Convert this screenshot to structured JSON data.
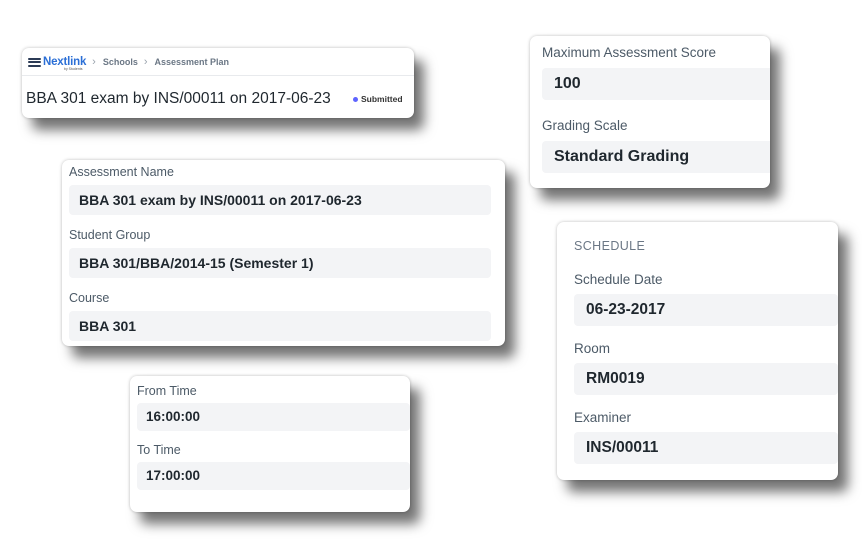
{
  "header": {
    "logo_text": "Nextlink",
    "logo_subtext": "by Students",
    "breadcrumbs": [
      "Schools",
      "Assessment Plan"
    ],
    "title": "BBA 301 exam by INS/00011 on 2017-06-23",
    "status": "Submitted",
    "status_color": "#5e64ff"
  },
  "assessment": {
    "name_label": "Assessment Name",
    "name_value": "BBA 301 exam by INS/00011 on 2017-06-23",
    "group_label": "Student Group",
    "group_value": "BBA 301/BBA/2014-15 (Semester 1)",
    "course_label": "Course",
    "course_value": "BBA 301"
  },
  "scoring": {
    "max_score_label": "Maximum Assessment Score",
    "max_score_value": "100",
    "grading_scale_label": "Grading Scale",
    "grading_scale_value": "Standard Grading"
  },
  "time": {
    "from_label": "From Time",
    "from_value": "16:00:00",
    "to_label": "To Time",
    "to_value": "17:00:00"
  },
  "schedule": {
    "section_title": "SCHEDULE",
    "date_label": "Schedule Date",
    "date_value": "06-23-2017",
    "room_label": "Room",
    "room_value": "RM0019",
    "examiner_label": "Examiner",
    "examiner_value": "INS/00011"
  }
}
